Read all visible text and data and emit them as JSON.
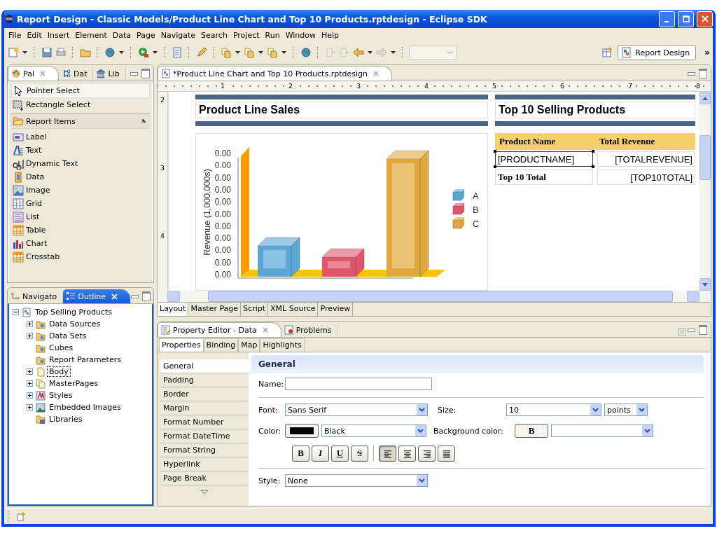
{
  "window": {
    "title": "Report Design - Classic Models/Product Line Chart and Top 10 Products.rptdesign - Eclipse SDK"
  },
  "menu": [
    "File",
    "Edit",
    "Insert",
    "Element",
    "Data",
    "Page",
    "Navigate",
    "Search",
    "Project",
    "Run",
    "Window",
    "Help"
  ],
  "toolbar": {
    "perspective": "Report Design",
    "overflow": "»"
  },
  "palette_view": {
    "tabs": [
      {
        "label": "Pal",
        "selected": true
      },
      {
        "label": "Dat",
        "selected": false
      },
      {
        "label": "Lib",
        "selected": false
      }
    ],
    "tools": [
      {
        "label": "Pointer Select",
        "kind": "pointer",
        "selected": true
      },
      {
        "label": "Rectangle Select",
        "kind": "marquee",
        "selected": false
      }
    ],
    "drawer": "Report Items",
    "items": [
      {
        "label": "Label",
        "kind": "label"
      },
      {
        "label": "Text",
        "kind": "text"
      },
      {
        "label": "Dynamic Text",
        "kind": "dynamic"
      },
      {
        "label": "Data",
        "kind": "data"
      },
      {
        "label": "Image",
        "kind": "image"
      },
      {
        "label": "Grid",
        "kind": "grid"
      },
      {
        "label": "List",
        "kind": "list"
      },
      {
        "label": "Table",
        "kind": "table"
      },
      {
        "label": "Chart",
        "kind": "chart"
      },
      {
        "label": "Crosstab",
        "kind": "table"
      }
    ]
  },
  "outline_view": {
    "tabs": [
      {
        "label": "Navigato",
        "selected": false
      },
      {
        "label": "Outline",
        "selected": true
      }
    ],
    "tree": [
      {
        "label": "Top Selling Products",
        "kind": "report",
        "expandable": true,
        "expanded": true,
        "selected": false,
        "children": [
          {
            "label": "Data Sources",
            "kind": "folder",
            "expandable": true,
            "expanded": false,
            "selected": false
          },
          {
            "label": "Data Sets",
            "kind": "folder",
            "expandable": true,
            "expanded": false,
            "selected": false
          },
          {
            "label": "Cubes",
            "kind": "folder",
            "expandable": false,
            "expanded": false,
            "selected": false
          },
          {
            "label": "Report Parameters",
            "kind": "folder",
            "expandable": false,
            "expanded": false,
            "selected": false
          },
          {
            "label": "Body",
            "kind": "page",
            "expandable": true,
            "expanded": false,
            "selected": true
          },
          {
            "label": "MasterPages",
            "kind": "pages",
            "expandable": true,
            "expanded": false,
            "selected": false
          },
          {
            "label": "Styles",
            "kind": "styles",
            "expandable": true,
            "expanded": false,
            "selected": false
          },
          {
            "label": "Embedded Images",
            "kind": "images",
            "expandable": true,
            "expanded": false,
            "selected": false
          },
          {
            "label": "Libraries",
            "kind": "library",
            "expandable": false,
            "expanded": false,
            "selected": false
          }
        ]
      }
    ]
  },
  "editor": {
    "tab": "*Product Line Chart and Top 10 Products.rptdesign",
    "ruler_h": [
      "1",
      "2",
      "3",
      "4",
      "5",
      "6",
      "7",
      "8"
    ],
    "ruler_v": [
      "2",
      "3",
      "4"
    ],
    "left_title": "Product Line Sales",
    "right_title": "Top 10 Selling Products",
    "chart": {
      "y_title": "Revenue (1,000,000s)",
      "y_ticks": [
        "0.00",
        "0.00",
        "0.00",
        "0.00",
        "0.00",
        "0.00",
        "0.00",
        "0.00",
        "0.00",
        "0.00",
        "0.00"
      ],
      "legend": [
        {
          "label": "A",
          "color": "#5aa7d6"
        },
        {
          "label": "B",
          "color": "#e0566a"
        },
        {
          "label": "C",
          "color": "#e2a93c"
        }
      ]
    },
    "table": {
      "columns": [
        "Product Name",
        "Total Revenue"
      ],
      "rows": [
        {
          "kind": "detail",
          "cells": [
            {
              "text": "[PRODUCTNAME]",
              "selected": true
            },
            {
              "text": "[TOTALREVENUE]",
              "selected": false
            }
          ]
        },
        {
          "kind": "footer",
          "cells": [
            {
              "text": "Top 10 Total",
              "selected": false
            },
            {
              "text": "[TOP10TOTAL]",
              "selected": false
            }
          ]
        }
      ]
    },
    "bottom_tabs": [
      {
        "label": "Layout",
        "selected": true
      },
      {
        "label": "Master Page",
        "selected": false
      },
      {
        "label": "Script",
        "selected": false
      },
      {
        "label": "XML Source",
        "selected": false
      },
      {
        "label": "Preview",
        "selected": false
      }
    ]
  },
  "property_view": {
    "tabs": [
      {
        "label": "Property Editor - Data",
        "selected": true
      },
      {
        "label": "Problems",
        "selected": false
      }
    ],
    "subtabs": [
      {
        "label": "Properties",
        "selected": true
      },
      {
        "label": "Binding",
        "selected": false
      },
      {
        "label": "Map",
        "selected": false
      },
      {
        "label": "Highlights",
        "selected": false
      }
    ],
    "categories": [
      {
        "label": "General",
        "selected": true
      },
      {
        "label": "Padding",
        "selected": false
      },
      {
        "label": "Border",
        "selected": false
      },
      {
        "label": "Margin",
        "selected": false
      },
      {
        "label": "Format Number",
        "selected": false
      },
      {
        "label": "Format DateTime",
        "selected": false
      },
      {
        "label": "Format String",
        "selected": false
      },
      {
        "label": "Hyperlink",
        "selected": false
      },
      {
        "label": "Page Break",
        "selected": false
      }
    ],
    "section": "General",
    "name_label": "Name:",
    "font_label": "Font:",
    "font": "Sans Serif",
    "size_label": "Size:",
    "size": "10",
    "size_unit": "points",
    "color_label": "Color:",
    "color_field": {
      "value": "Black",
      "color": "#000000"
    },
    "bg_label": "Background color:",
    "bg_button": "B",
    "format_buttons": [
      {
        "label": "B",
        "kind": "bold",
        "selected": false
      },
      {
        "label": "I",
        "kind": "italic",
        "selected": false
      },
      {
        "label": "U",
        "kind": "underline",
        "selected": false
      },
      {
        "label": "S",
        "kind": "strike",
        "selected": false
      }
    ],
    "align_buttons": [
      {
        "kind": "left",
        "selected": true
      },
      {
        "kind": "center",
        "selected": false
      },
      {
        "kind": "right",
        "selected": false
      },
      {
        "kind": "justify",
        "selected": false
      }
    ],
    "style_label": "Style:",
    "style": "None"
  }
}
